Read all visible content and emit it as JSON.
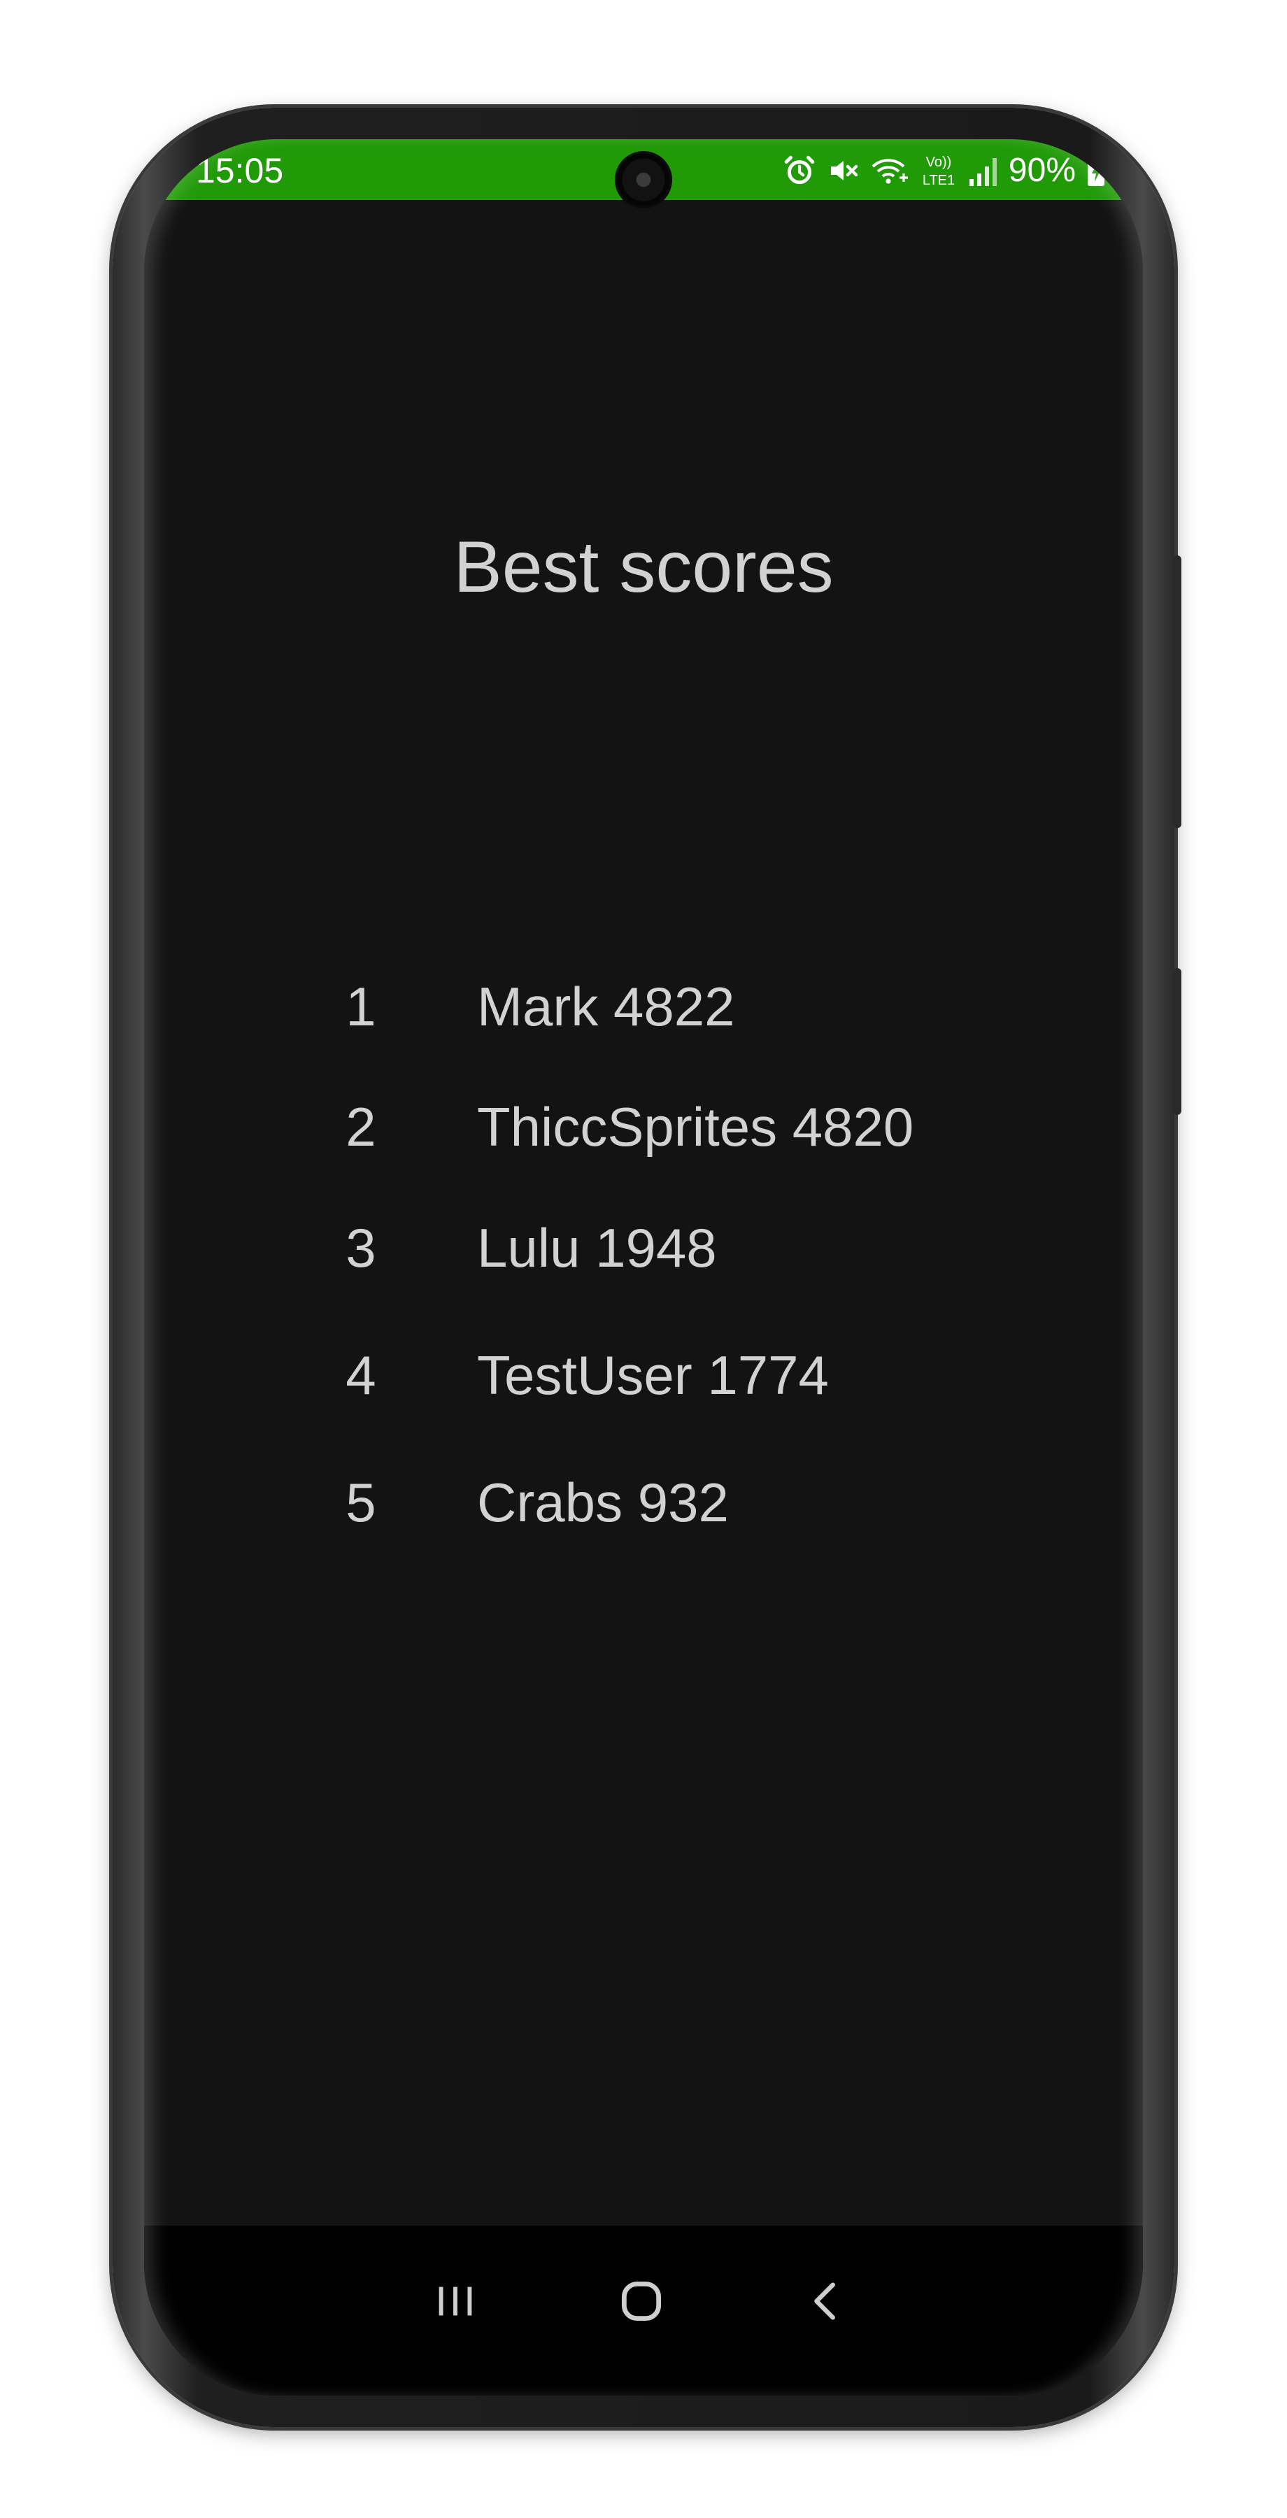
{
  "status_bar": {
    "time": "15:05",
    "battery_percent": "90%",
    "background_color": "#219a08",
    "icons": [
      "alarm-icon",
      "mute-icon",
      "wifi-calling-icon",
      "volte-lte-icon",
      "signal-icon",
      "battery-charging-icon"
    ],
    "volte_label_top": "Vo))",
    "volte_label_bottom": "LTE1"
  },
  "page": {
    "title": "Best scores",
    "background_color": "#131313",
    "text_color": "#d2d2d2"
  },
  "scores": [
    {
      "rank": "1",
      "entry": "Mark 4822"
    },
    {
      "rank": "2",
      "entry": "ThiccSprites 4820"
    },
    {
      "rank": "3",
      "entry": "Lulu 1948"
    },
    {
      "rank": "4",
      "entry": "TestUser 1774"
    },
    {
      "rank": "5",
      "entry": "Crabs 932"
    }
  ],
  "nav_bar": {
    "buttons": [
      "recents-icon",
      "home-icon",
      "back-icon"
    ]
  }
}
